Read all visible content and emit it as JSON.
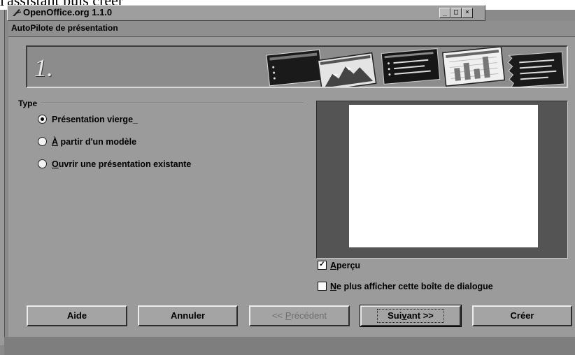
{
  "background_text": "l'assistant puis créer",
  "app_window": {
    "title": "OpenOffice.org 1.1.0",
    "icon": "openoffice-logo-icon",
    "controls": [
      "_",
      "□",
      "×"
    ]
  },
  "dialog": {
    "title": "AutoPilote de présentation",
    "banner": {
      "step_number": "1.",
      "illustration": [
        "dark-slide-bullets",
        "mountain-chart-slide",
        "dark-slide-lines",
        "bar-chart-slide",
        "torn-slide-lines"
      ]
    },
    "type_group": {
      "label": "Type",
      "options": [
        {
          "label": "Présentation vierge_",
          "selected": true
        },
        {
          "label_mnemonic": "À",
          "label_rest": " partir d'un modèle",
          "selected": false
        },
        {
          "label_mnemonic": "O",
          "label_rest": "uvrir une présentation existante",
          "selected": false
        }
      ]
    },
    "preview": {
      "label_mnemonic": "A",
      "label_rest": "perçu",
      "checked": true
    },
    "dont_show": {
      "label_mnemonic": "N",
      "label_rest": "e plus afficher cette boîte de dialogue",
      "checked": false
    },
    "buttons": {
      "help": "Aide",
      "cancel": "Annuler",
      "back_prefix": "<< ",
      "back_mnemonic": "P",
      "back_rest": "récédent",
      "next_prefix": "Sui",
      "next_mnemonic": "v",
      "next_rest": "ant >>",
      "create": "Créer"
    }
  },
  "colors": {
    "dialog_bg": "#9b9b9b",
    "preview_frame": "#545454",
    "preview_slide": "#ffffff",
    "disabled_text": "#6f6f6f"
  }
}
